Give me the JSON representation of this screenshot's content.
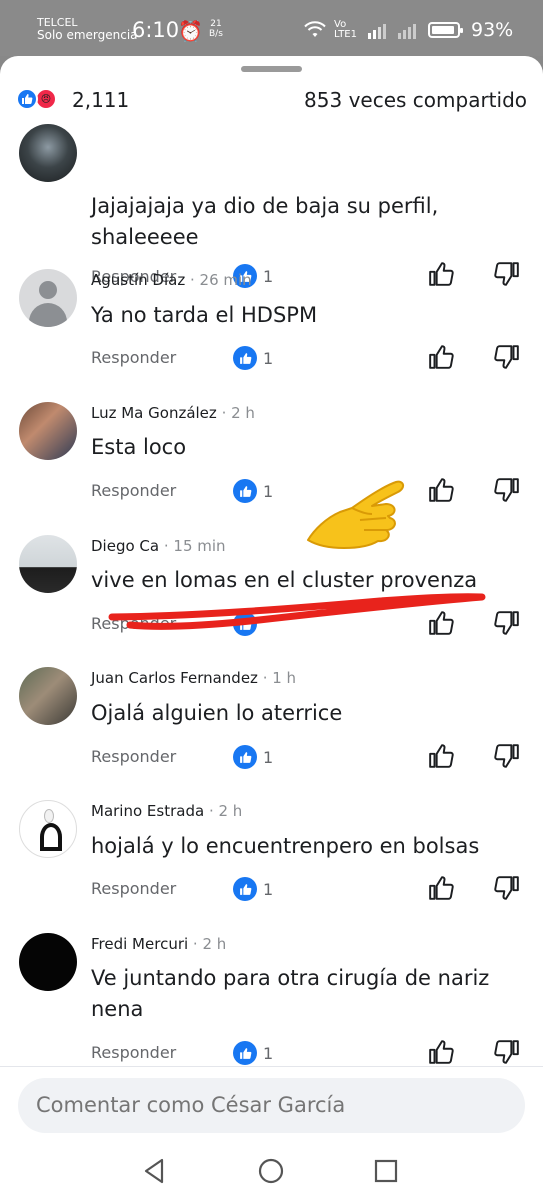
{
  "status_bar": {
    "carrier": "TELCEL",
    "carrier_status": "Solo emergencia",
    "time": "6:10",
    "data_speed_value": "21",
    "data_speed_unit": "B/s",
    "network": "Vo LTE1",
    "battery": "93%"
  },
  "summary": {
    "reaction_count": "2,111",
    "shares": "853 veces compartido"
  },
  "comments": [
    {
      "author": "",
      "time": "",
      "text": "Jajajajaja ya dio de baja su perfil, shaleeeee",
      "reply": "Responder",
      "likes": "1",
      "avatar": "dark"
    },
    {
      "author": "Agustín Díaz",
      "time": " · 26 min",
      "text": "Ya no tarda el HDSPM",
      "reply": "Responder",
      "likes": "1",
      "avatar": "gray"
    },
    {
      "author": "Luz Ma González",
      "time": " · 2 h",
      "text": "Esta loco",
      "reply": "Responder",
      "likes": "1",
      "avatar": "photo1"
    },
    {
      "author": "Diego Ca",
      "time": " · 15 min",
      "text": "vive en lomas en el cluster provenza",
      "reply": "Responder",
      "likes": "1",
      "avatar": "photo2"
    },
    {
      "author": "Juan Carlos Fernandez",
      "time": " · 1 h",
      "text": "Ojalá alguien lo aterrice",
      "reply": "Responder",
      "likes": "1",
      "avatar": "photo3"
    },
    {
      "author": "Marino Estrada",
      "time": " · 2 h",
      "text": "hojalá y lo encuentrenpero en bolsas",
      "reply": "Responder",
      "likes": "1",
      "avatar": "memorial"
    },
    {
      "author": "Fredi Mercuri",
      "time": " · 2 h",
      "text": "Ve juntando para otra cirugía de nariz nena",
      "reply": "Responder",
      "likes": "1",
      "avatar": "black"
    }
  ],
  "composer": {
    "placeholder": "Comentar como César García"
  },
  "colors": {
    "facebook_blue": "#1877f2",
    "angry_red": "#f02849",
    "annotation_red": "#e8231c",
    "pointer_yellow": "#f7c21b"
  },
  "icons": [
    "like-icon",
    "angry-icon",
    "thumbs-up-icon",
    "thumbs-down-icon",
    "back-icon",
    "home-icon",
    "recents-icon",
    "pointing-hand-emoji"
  ]
}
